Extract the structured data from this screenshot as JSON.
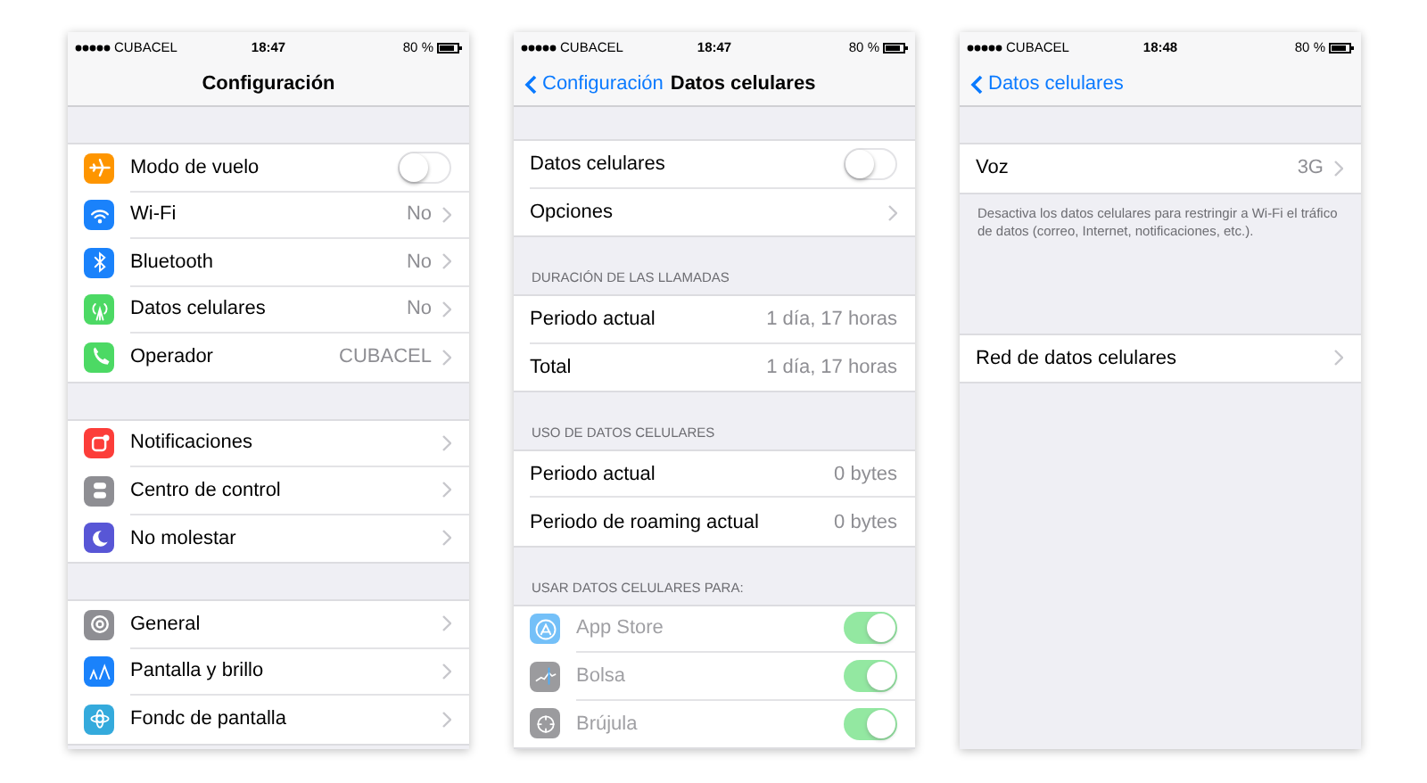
{
  "screens": [
    {
      "status": {
        "carrier": "CUBACEL",
        "time": "18:47",
        "battery": "80 %"
      },
      "nav": {
        "title": "Configuración"
      },
      "sections": [
        {
          "rows": [
            {
              "kind": "toggle",
              "color": "#fe9500",
              "label": "Modo de vuelo",
              "on": false,
              "disabled": false
            },
            {
              "kind": "link",
              "color": "#1a82fb",
              "label": "Wi-Fi",
              "value": "No"
            },
            {
              "kind": "link",
              "color": "#1a82fb",
              "label": "Bluetooth",
              "value": "No"
            },
            {
              "kind": "link",
              "color": "#4cd964",
              "label": "Datos celulares",
              "value": "No"
            },
            {
              "kind": "link",
              "color": "#4cd964",
              "label": "Operador",
              "value": "CUBACEL"
            }
          ]
        },
        {
          "rows": [
            {
              "kind": "link",
              "color": "#fc3d39",
              "label": "Notificaciones"
            },
            {
              "kind": "link",
              "color": "#8e8e93",
              "label": "Centro de control"
            },
            {
              "kind": "link",
              "color": "#5856d6",
              "label": "No molestar"
            }
          ]
        },
        {
          "rows": [
            {
              "kind": "link",
              "color": "#8e8e93",
              "label": "General"
            },
            {
              "kind": "link",
              "color": "#1a82fb",
              "label": "Pantalla y brillo"
            },
            {
              "kind": "link",
              "color": "#34aadc",
              "label": "Fondc de pantalla"
            }
          ]
        }
      ]
    },
    {
      "status": {
        "carrier": "CUBACEL",
        "time": "18:47",
        "battery": "80 %"
      },
      "nav": {
        "back": "Configuración",
        "title": "Datos celulares"
      },
      "sections": [
        {
          "rows": [
            {
              "kind": "toggle",
              "label": "Datos celulares",
              "on": false,
              "disabled": false
            },
            {
              "kind": "link",
              "label": "Opciones"
            }
          ]
        },
        {
          "header": "DURACIÓN DE LAS LLAMADAS",
          "rows": [
            {
              "kind": "info",
              "label": "Periodo actual",
              "value": "1 día, 17 horas"
            },
            {
              "kind": "info",
              "label": "Total",
              "value": "1 día, 17 horas"
            }
          ]
        },
        {
          "header": "USO DE DATOS CELULARES",
          "rows": [
            {
              "kind": "info",
              "label": "Periodo actual",
              "value": "0 bytes"
            },
            {
              "kind": "info",
              "label": "Periodo de roaming actual",
              "value": "0 bytes"
            }
          ]
        },
        {
          "header": "USAR DATOS CELULARES PARA:",
          "rows": [
            {
              "kind": "toggle",
              "color": "#74c0f8",
              "label": "App Store",
              "on": true,
              "disabled": true
            },
            {
              "kind": "toggle",
              "color": "#9b9b9e",
              "label": "Bolsa",
              "on": true,
              "disabled": true
            },
            {
              "kind": "toggle",
              "color": "#9b9b9e",
              "label": "Brújula",
              "on": true,
              "disabled": true
            }
          ]
        }
      ]
    },
    {
      "status": {
        "carrier": "CUBACEL",
        "time": "18:48",
        "battery": "80 %"
      },
      "nav": {
        "back": "Datos celulares"
      },
      "sections": [
        {
          "rows": [
            {
              "kind": "link",
              "label": "Voz",
              "value": "3G"
            }
          ],
          "footer": "Desactiva los datos celulares para restringir a Wi-Fi el tráfico de datos (correo, Internet, notificaciones, etc.)."
        },
        {
          "rows": [
            {
              "kind": "link",
              "label": "Red de datos celulares"
            }
          ]
        }
      ]
    }
  ]
}
